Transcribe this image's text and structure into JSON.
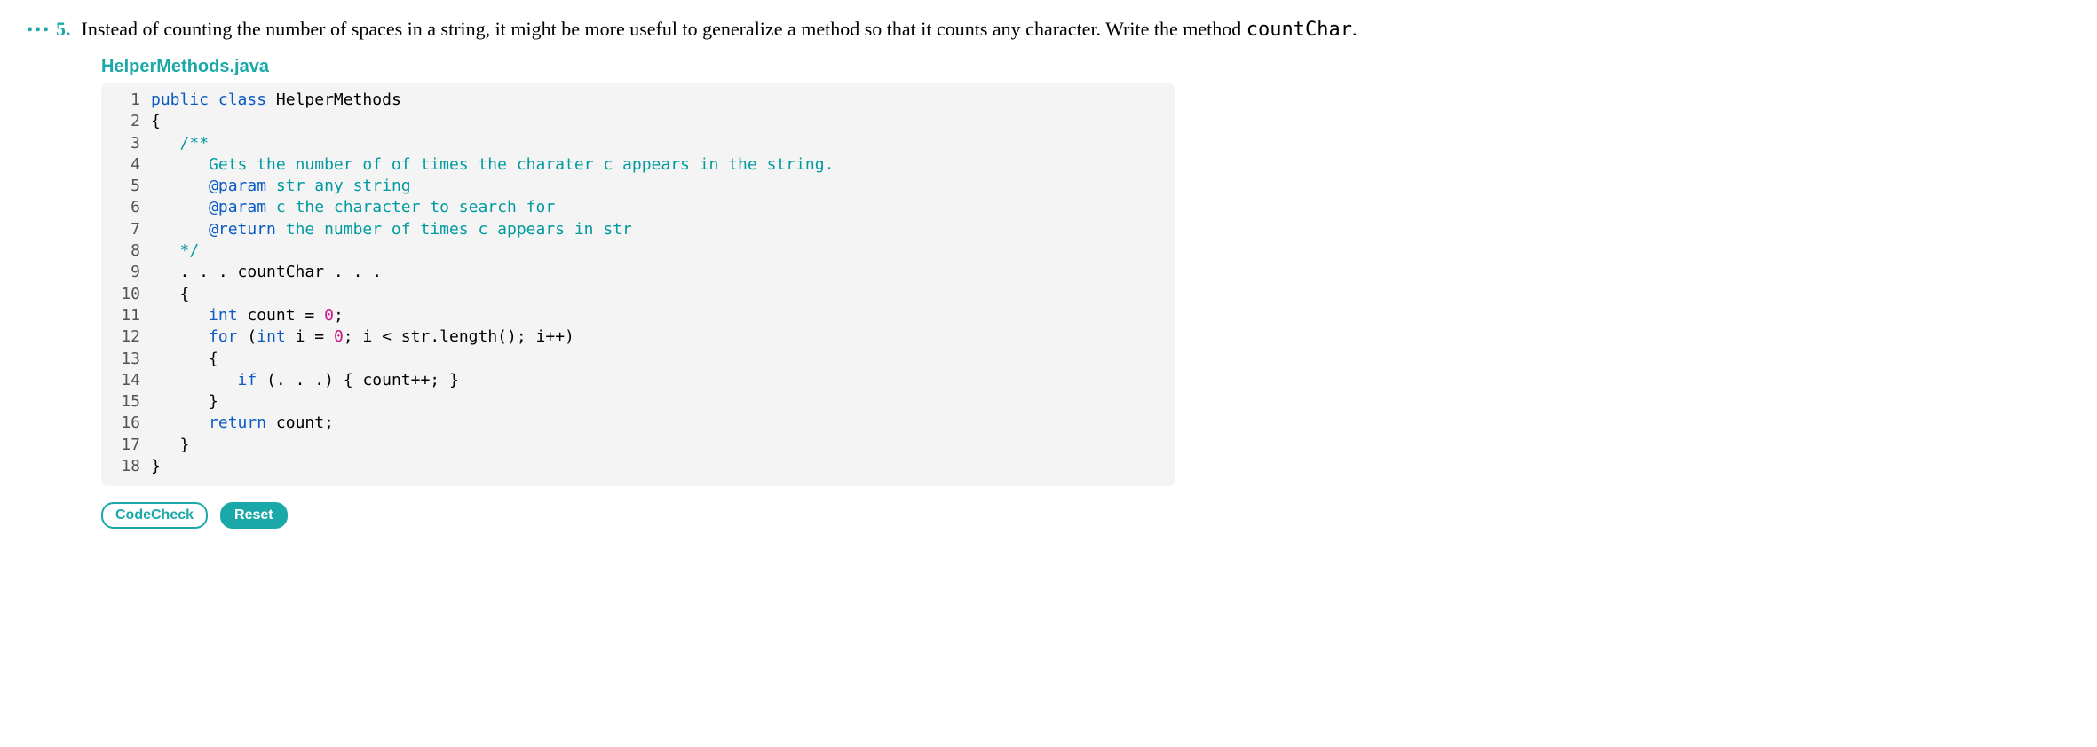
{
  "problem": {
    "dots": "•••",
    "number": "5.",
    "prompt_prefix": "Instead of counting the number of spaces in a string, it might be more useful to generalize a method so that it counts any character. Write the method ",
    "prompt_code": "countChar",
    "prompt_suffix": "."
  },
  "filename": "HelperMethods.java",
  "code": {
    "lines": [
      {
        "n": "1",
        "segs": [
          {
            "t": "public",
            "c": "k-blue"
          },
          {
            "t": " "
          },
          {
            "t": "class",
            "c": "k-blue"
          },
          {
            "t": " HelperMethods"
          }
        ]
      },
      {
        "n": "2",
        "segs": [
          {
            "t": "{"
          }
        ]
      },
      {
        "n": "3",
        "segs": [
          {
            "t": "   "
          },
          {
            "t": "/**",
            "c": "k-teal"
          }
        ]
      },
      {
        "n": "4",
        "segs": [
          {
            "t": "      "
          },
          {
            "t": "Gets the number of of times the charater c appears in the string.",
            "c": "k-teal"
          }
        ]
      },
      {
        "n": "5",
        "segs": [
          {
            "t": "      "
          },
          {
            "t": "@param",
            "c": "k-blue"
          },
          {
            "t": " str any string",
            "c": "k-teal"
          }
        ]
      },
      {
        "n": "6",
        "segs": [
          {
            "t": "      "
          },
          {
            "t": "@param",
            "c": "k-blue"
          },
          {
            "t": " c the character to search for",
            "c": "k-teal"
          }
        ]
      },
      {
        "n": "7",
        "segs": [
          {
            "t": "      "
          },
          {
            "t": "@return",
            "c": "k-blue"
          },
          {
            "t": " the number of times c appears in str",
            "c": "k-teal"
          }
        ]
      },
      {
        "n": "8",
        "segs": [
          {
            "t": "   "
          },
          {
            "t": "*/",
            "c": "k-teal"
          }
        ]
      },
      {
        "n": "9",
        "segs": [
          {
            "t": "   . . . countChar . . ."
          }
        ]
      },
      {
        "n": "10",
        "segs": [
          {
            "t": "   {"
          }
        ]
      },
      {
        "n": "11",
        "segs": [
          {
            "t": "      "
          },
          {
            "t": "int",
            "c": "k-blue"
          },
          {
            "t": " count = "
          },
          {
            "t": "0",
            "c": "k-num"
          },
          {
            "t": ";"
          }
        ]
      },
      {
        "n": "12",
        "segs": [
          {
            "t": "      "
          },
          {
            "t": "for",
            "c": "k-blue"
          },
          {
            "t": " ("
          },
          {
            "t": "int",
            "c": "k-blue"
          },
          {
            "t": " i = "
          },
          {
            "t": "0",
            "c": "k-num"
          },
          {
            "t": "; i < str.length(); i++)"
          }
        ]
      },
      {
        "n": "13",
        "segs": [
          {
            "t": "      {"
          }
        ]
      },
      {
        "n": "14",
        "segs": [
          {
            "t": "         "
          },
          {
            "t": "if",
            "c": "k-blue"
          },
          {
            "t": " (. . .) { count++; }"
          }
        ]
      },
      {
        "n": "15",
        "segs": [
          {
            "t": "      }"
          }
        ]
      },
      {
        "n": "16",
        "segs": [
          {
            "t": "      "
          },
          {
            "t": "return",
            "c": "k-blue"
          },
          {
            "t": " count;"
          }
        ]
      },
      {
        "n": "17",
        "segs": [
          {
            "t": "   }"
          }
        ]
      },
      {
        "n": "18",
        "segs": [
          {
            "t": "}"
          }
        ]
      }
    ]
  },
  "buttons": {
    "codecheck": "CodeCheck",
    "reset": "Reset"
  }
}
